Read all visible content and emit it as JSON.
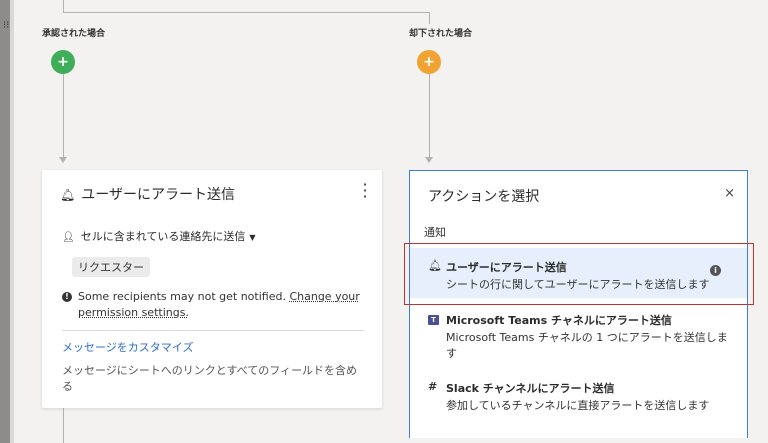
{
  "flow": {
    "approved_label": "承認された場合",
    "rejected_label": "却下された場合",
    "approved_color": "#3fae5a",
    "rejected_color": "#f0a332",
    "add_glyph": "+"
  },
  "card": {
    "title": "ユーザーにアラート送信",
    "icon": "bell-icon",
    "send_to_label": "セルに含まれている連絡先に送信",
    "chip_label": "リクエスター",
    "warning_text": "Some recipients may not get notified.",
    "warning_link": "Change your",
    "warning_link_2": "permission settings.",
    "customize_link": "メッセージをカスタマイズ",
    "customize_desc": "メッセージにシートへのリンクとすべてのフィールドを含める"
  },
  "panel": {
    "title": "アクションを選択",
    "close_glyph": "×",
    "section_label": "通知",
    "options": [
      {
        "title": "ユーザーにアラート送信",
        "desc": "シートの行に関してユーザーにアラートを送信します",
        "icon": "bell-icon"
      },
      {
        "title": "Microsoft Teams チャネルにアラート送信",
        "desc": "Microsoft Teams チャネルの 1 つにアラートを送信します",
        "icon": "teams-icon"
      },
      {
        "title": "Slack チャンネルにアラート送信",
        "desc": "参加しているチャンネルに直接アラートを送信します",
        "icon": "slack-icon"
      }
    ]
  },
  "colors": {
    "accent_blue": "#3b7dd8",
    "link_blue": "#2c6dd3",
    "selected_bg": "#e6effb",
    "highlight_red": "#c0362c"
  }
}
